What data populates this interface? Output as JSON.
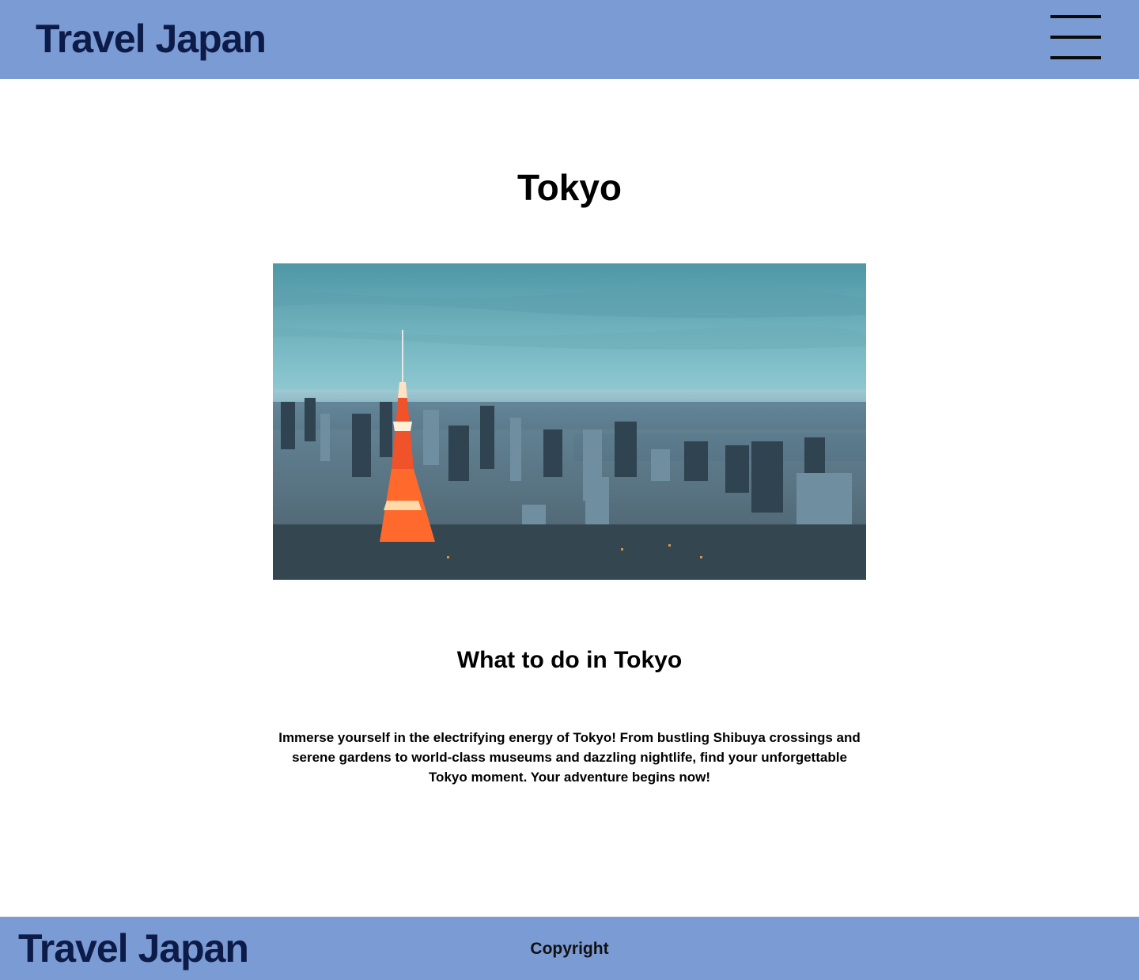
{
  "header": {
    "title": "Travel Japan",
    "menu_icon": "hamburger-menu-icon"
  },
  "main": {
    "title": "Tokyo",
    "image": {
      "subject": "tokyo-skyline-photo"
    },
    "section_title": "What to do in Tokyo",
    "description": "Immerse yourself in the electrifying energy of Tokyo! From bustling Shibuya crossings and serene gardens to world-class museums and dazzling nightlife, find your unforgettable Tokyo moment. Your adventure begins now!"
  },
  "footer": {
    "title": "Travel Japan",
    "copyright": "Copyright"
  },
  "colors": {
    "bar": "#7b9bd4",
    "brand_text": "#0d1b48",
    "body_text": "#000000"
  }
}
